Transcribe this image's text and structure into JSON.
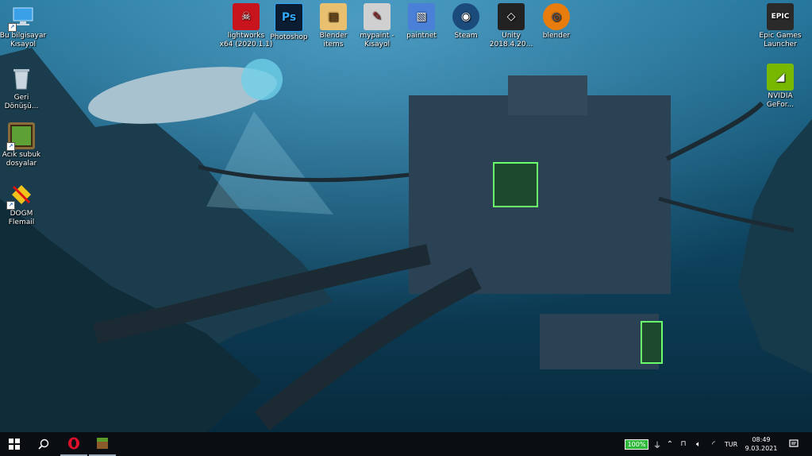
{
  "desktop": {
    "icons_left": [
      {
        "name": "Bu bilgisayar",
        "lines": [
          "Bu bilgisayar",
          "Kısayol"
        ]
      },
      {
        "name": "Geri Dönüşüm",
        "lines": [
          "Geri",
          "Dönüşü..."
        ]
      },
      {
        "name": "Acık subuk dosyalar",
        "lines": [
          "Acık subuk",
          "dosyalar"
        ]
      },
      {
        "name": "DOGM Flemail",
        "lines": [
          "DOGM",
          "Flemail"
        ]
      }
    ],
    "icons_top": [
      {
        "lines": [
          "lightworks",
          "x64 (2020.1.1)"
        ],
        "glyph": "☠",
        "bg": "#c8141c"
      },
      {
        "lines": [
          "Photoshop",
          ""
        ],
        "glyph": "Ps",
        "bg": "#0b1d33",
        "fg": "#31a8ff"
      },
      {
        "lines": [
          "Blender",
          "items"
        ],
        "glyph": "▤",
        "bg": "#e8c070"
      },
      {
        "lines": [
          "mypaint -",
          "Kısayol"
        ],
        "glyph": "✎",
        "bg": "#d0d0d0"
      },
      {
        "lines": [
          "paintnet",
          ""
        ],
        "glyph": "▧",
        "bg": "#4a80d8"
      },
      {
        "lines": [
          "Steam",
          ""
        ],
        "glyph": "◉",
        "bg": "#1b4b7a"
      },
      {
        "lines": [
          "Unity",
          "2018.4.20..."
        ],
        "glyph": "◇",
        "bg": "#222"
      },
      {
        "lines": [
          "blender",
          ""
        ],
        "glyph": "◎",
        "bg": "#e87d0d"
      }
    ],
    "icons_right": [
      {
        "lines": [
          "Epic Games",
          "Launcher"
        ],
        "glyph": "EPIC",
        "bg": "#2a2a2a"
      },
      {
        "lines": [
          "NVIDIA",
          "GeFor..."
        ],
        "glyph": "◢",
        "bg": "#76b900"
      }
    ]
  },
  "taskbar": {
    "start_icon": "windows-icon",
    "search_icon": "search-icon",
    "battery": "100%",
    "language": "TUR",
    "time": "08:49",
    "date": "9.03.2021"
  }
}
